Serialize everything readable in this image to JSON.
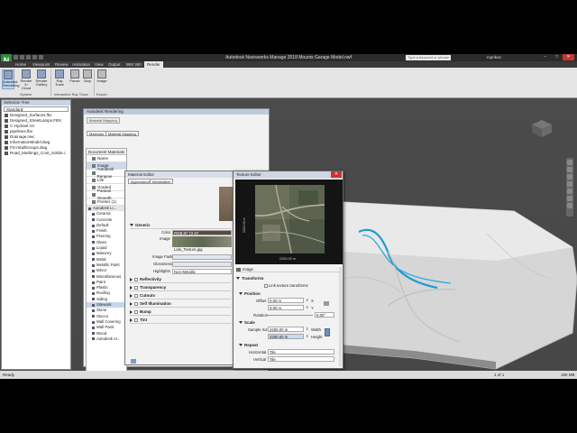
{
  "window": {
    "title": "Autodesk Navisworks Manage 2018   Mounts Garage Model.nwf",
    "search_placeholder": "Type a keyword or phrase",
    "user": "mprikos"
  },
  "menu": {
    "tabs": [
      "Home",
      "Viewpoint",
      "Review",
      "Animation",
      "View",
      "Output",
      "BIM 360",
      "Render"
    ],
    "active": "Render"
  },
  "ribbon": {
    "buttons": [
      {
        "label": "Autodesk Rendering",
        "active": true
      },
      {
        "label": "Render in Cloud",
        "active": false
      },
      {
        "label": "Render Gallery",
        "active": false
      },
      {
        "label": "Ray Trace",
        "active": false
      },
      {
        "label": "Pause",
        "active": false
      },
      {
        "label": "Stop",
        "active": false
      },
      {
        "label": "Image",
        "active": false
      }
    ],
    "groups": [
      "System",
      "Interactive Ray Trace",
      "Export"
    ]
  },
  "selection_tree": {
    "title": "Selection Tree",
    "dropdown": "Standard",
    "items": [
      "Designed_Surfaces.fbx",
      "Designed_StreetLamps.FBX",
      "C-Hydrant.rvt",
      "pipelines.fbx",
      "Drainage.nwc",
      "InformationModel.dwg",
      "FS-retailGroups.dwg",
      "Road_Markings_Cont_Solids.c"
    ]
  },
  "render_panel": {
    "title": "Autodesk Rendering",
    "button": "Material Mapping",
    "tabs": [
      "Materials",
      "Material Mapping"
    ],
    "doc_materials_header": "Document Materials",
    "properties": [
      "Name",
      "Image",
      "Autodesk Renpow",
      "Life",
      "Graded",
      "Parasol Smooth",
      "Pointer (1)"
    ],
    "library_header": "Autodesk Li...",
    "library_items": [
      "Ceramic",
      "Concrete",
      "Default",
      "Finish",
      "Flooring",
      "Glass",
      "Liquid",
      "Masonry",
      "Metal",
      "Metallic Paint",
      "Mirror",
      "Miscellaneous",
      "Paint",
      "Plastic",
      "Roofing",
      "Siding",
      "Sitework",
      "Stone",
      "Stucco",
      "Wall Covering",
      "Wall Paint",
      "Wood",
      "Autodesk Ar..."
    ],
    "library_selected": "Sitework",
    "material_list": [
      {
        "name": "Sand",
        "category": "Sitework",
        "color": "#c8c0a8"
      },
      {
        "name": "Sand - Natural Medium",
        "category": "Sitework",
        "color": "#b8a888"
      },
      {
        "name": "Shadowbox Traffic",
        "category": "Sitework",
        "color": "#6a4a30"
      },
      {
        "name": "Snow",
        "category": "Sitework",
        "color": "#f4f4f4"
      },
      {
        "name": "Soil",
        "category": "Sitework",
        "color": "#8a7660"
      },
      {
        "name": "Wood Mulch",
        "category": "Sitework",
        "color": "#5a3c22"
      }
    ]
  },
  "material_editor": {
    "title": "Material Editor",
    "tabs": [
      "Appearance",
      "Information"
    ],
    "generic_header": "Generic",
    "color_label": "Color",
    "color_value": "RGB 87 72 67",
    "image_label": "Image",
    "image_file": "Lalo_Texture.jpg",
    "image_fade_label": "Image Fade",
    "glossiness_label": "Glossiness",
    "highlights_label": "Highlights",
    "highlights_value": "Non-Metallic",
    "sections": [
      "Reflectivity",
      "Transparency",
      "Cutouts",
      "Self Illumination",
      "Bump",
      "Tint"
    ]
  },
  "texture_editor": {
    "title": "Texture Editor",
    "dim_horizontal": "2250.00 m",
    "dim_vertical": "2250.00 m",
    "image_label": "Image",
    "transforms_label": "Transforms",
    "link_label": "Link texture transforms",
    "position_label": "Position",
    "offset_label": "Offset",
    "offset_x": "0.00 m",
    "offset_y": "0.00 m",
    "x_label": "X",
    "y_label": "Y",
    "rotation_label": "Rotation",
    "rotation_value": "0.00°",
    "scale_label": "Scale",
    "sample_size_label": "Sample Size",
    "width_value": "2250.00 m",
    "height_value": "2250.00 m",
    "width_label": "Width",
    "height_label": "Height",
    "repeat_label": "Repeat",
    "horizontal_label": "Horizontal",
    "horizontal_value": "Tile",
    "vertical_label": "Vertical",
    "vertical_value": "Tile"
  },
  "status": {
    "left": "Ready",
    "page": "1 of 1",
    "memory": "190 MB"
  }
}
